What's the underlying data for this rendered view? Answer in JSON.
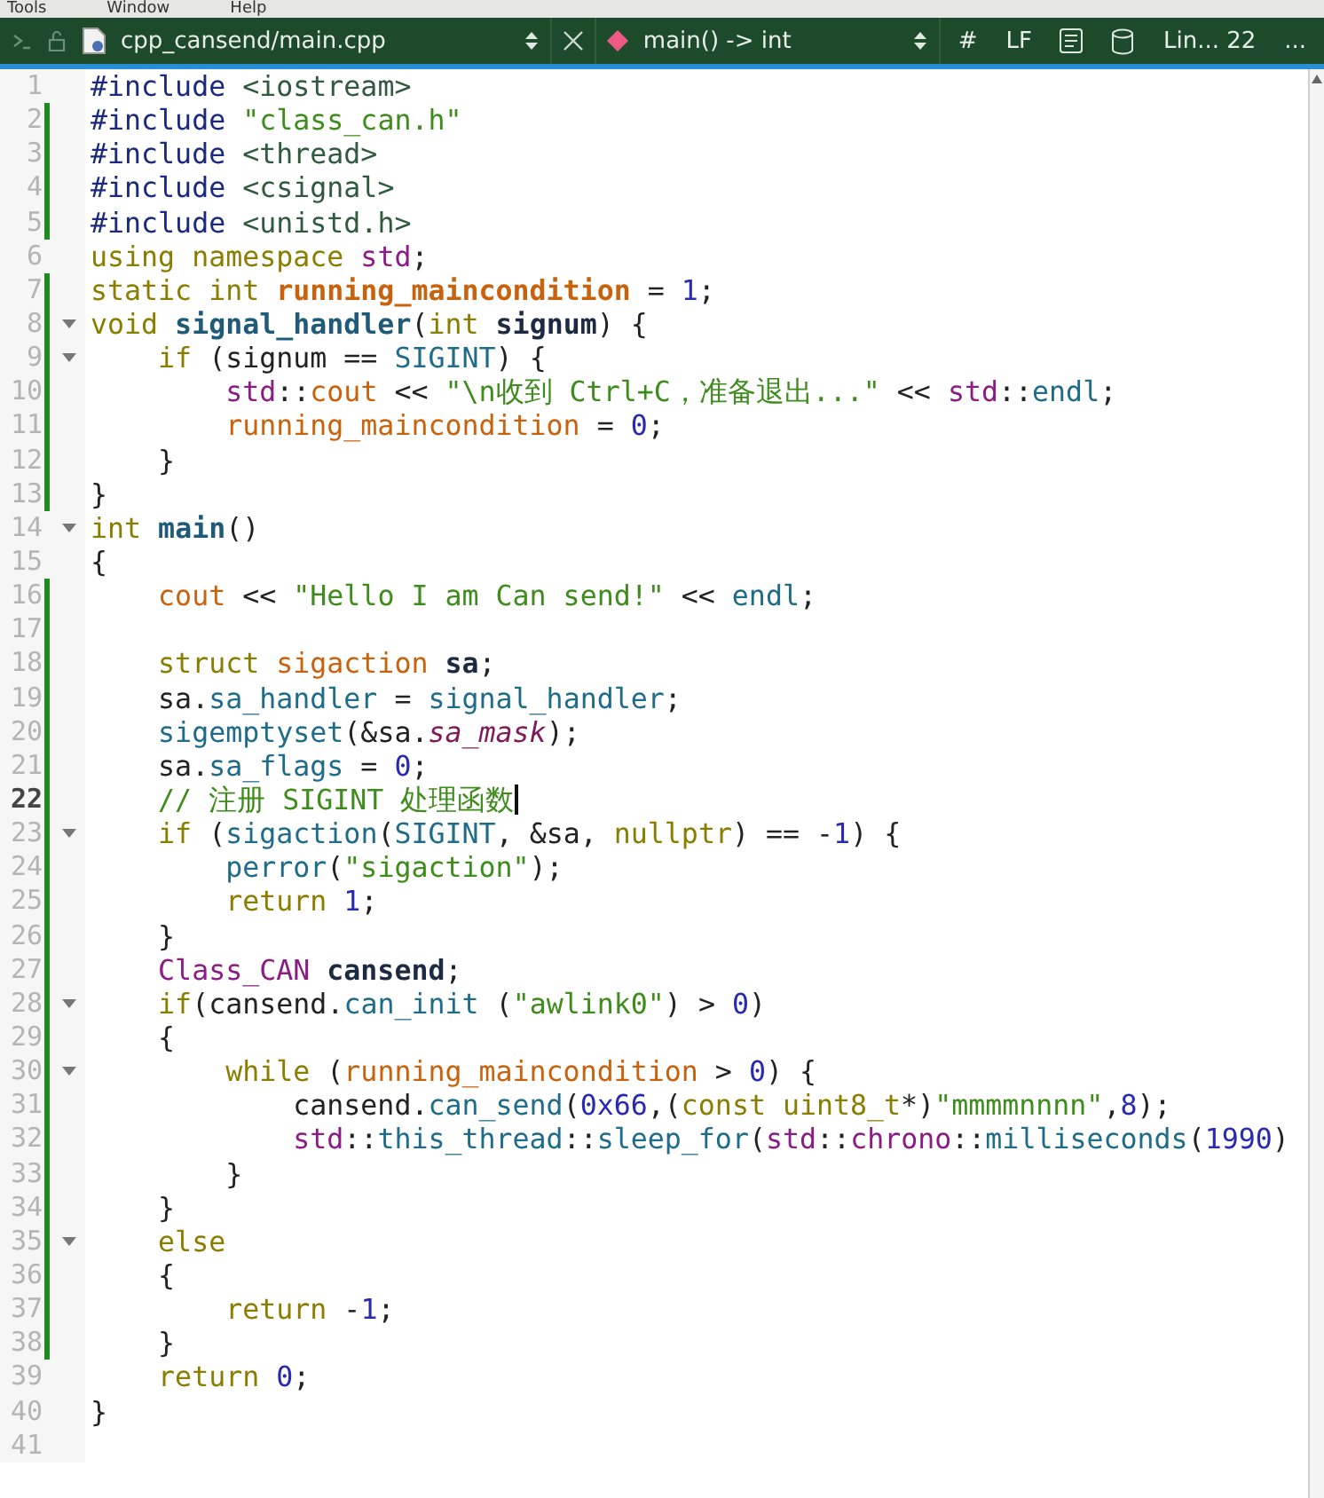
{
  "menu": [
    {
      "label": "Tools"
    },
    {
      "label": "Window"
    },
    {
      "label": "Help"
    }
  ],
  "toolbar": {
    "file": "cpp_cansend/main.cpp",
    "symbol": "main() -> int",
    "hash": "#",
    "line_ending": "LF",
    "position": "Lin... 22",
    "more": "..."
  },
  "editor": {
    "lines": [
      {
        "number": "1",
        "changed": false,
        "fold": false,
        "selected": false,
        "tokens": [
          {
            "kind": "pre",
            "text": "#include"
          },
          {
            "kind": "hdr",
            "text": " <iostream>"
          }
        ]
      },
      {
        "number": "2",
        "changed": true,
        "fold": false,
        "selected": false,
        "tokens": [
          {
            "kind": "pre",
            "text": "#include"
          },
          {
            "kind": "str",
            "text": " \"class_can.h\""
          }
        ]
      },
      {
        "number": "3",
        "changed": true,
        "fold": false,
        "selected": false,
        "tokens": [
          {
            "kind": "pre",
            "text": "#include"
          },
          {
            "kind": "hdr",
            "text": " <thread>"
          }
        ]
      },
      {
        "number": "4",
        "changed": true,
        "fold": false,
        "selected": false,
        "tokens": [
          {
            "kind": "pre",
            "text": "#include"
          },
          {
            "kind": "hdr",
            "text": " <csignal>"
          }
        ]
      },
      {
        "number": "5",
        "changed": true,
        "fold": false,
        "selected": false,
        "tokens": [
          {
            "kind": "pre",
            "text": "#include"
          },
          {
            "kind": "hdr",
            "text": " <unistd.h>"
          }
        ]
      },
      {
        "number": "6",
        "changed": false,
        "fold": false,
        "selected": false,
        "tokens": [
          {
            "kind": "kw",
            "text": "using namespace"
          },
          {
            "kind": "ns",
            "text": " std"
          },
          {
            "kind": "plain",
            "text": ";"
          }
        ]
      },
      {
        "number": "7",
        "changed": true,
        "fold": false,
        "selected": false,
        "tokens": [
          {
            "kind": "kw",
            "text": "static int"
          },
          {
            "kind": "varb",
            "text": " running_maincondition"
          },
          {
            "kind": "plain",
            "text": " = "
          },
          {
            "kind": "num",
            "text": "1"
          },
          {
            "kind": "plain",
            "text": ";"
          }
        ]
      },
      {
        "number": "8",
        "changed": true,
        "fold": true,
        "selected": false,
        "tokens": [
          {
            "kind": "kw",
            "text": "void"
          },
          {
            "kind": "fnb",
            "text": " signal_handler"
          },
          {
            "kind": "plain",
            "text": "("
          },
          {
            "kind": "kw",
            "text": "int"
          },
          {
            "kind": "plainb",
            "text": " signum"
          },
          {
            "kind": "plain",
            "text": ") {"
          }
        ]
      },
      {
        "number": "9",
        "changed": true,
        "fold": true,
        "selected": false,
        "tokens": [
          {
            "kind": "kw",
            "text": "    if"
          },
          {
            "kind": "plain",
            "text": " (signum == "
          },
          {
            "kind": "fn",
            "text": "SIGINT"
          },
          {
            "kind": "plain",
            "text": ") {"
          }
        ]
      },
      {
        "number": "10",
        "changed": true,
        "fold": false,
        "selected": false,
        "tokens": [
          {
            "kind": "ns",
            "text": "        std"
          },
          {
            "kind": "plain",
            "text": "::"
          },
          {
            "kind": "var",
            "text": "cout"
          },
          {
            "kind": "plain",
            "text": " << "
          },
          {
            "kind": "str",
            "text": "\"\\n收到 Ctrl+C，准备退出...\""
          },
          {
            "kind": "plain",
            "text": " << "
          },
          {
            "kind": "ns",
            "text": "std"
          },
          {
            "kind": "plain",
            "text": "::"
          },
          {
            "kind": "fn",
            "text": "endl"
          },
          {
            "kind": "plain",
            "text": ";"
          }
        ]
      },
      {
        "number": "11",
        "changed": true,
        "fold": false,
        "selected": false,
        "tokens": [
          {
            "kind": "var",
            "text": "        running_maincondition"
          },
          {
            "kind": "plain",
            "text": " = "
          },
          {
            "kind": "num",
            "text": "0"
          },
          {
            "kind": "plain",
            "text": ";"
          }
        ]
      },
      {
        "number": "12",
        "changed": true,
        "fold": false,
        "selected": false,
        "tokens": [
          {
            "kind": "plain",
            "text": "    }"
          }
        ]
      },
      {
        "number": "13",
        "changed": true,
        "fold": false,
        "selected": false,
        "tokens": [
          {
            "kind": "plain",
            "text": "}"
          }
        ]
      },
      {
        "number": "14",
        "changed": false,
        "fold": true,
        "selected": false,
        "tokens": [
          {
            "kind": "kw",
            "text": "int"
          },
          {
            "kind": "fnb",
            "text": " main"
          },
          {
            "kind": "plain",
            "text": "()"
          }
        ]
      },
      {
        "number": "15",
        "changed": false,
        "fold": false,
        "selected": false,
        "tokens": [
          {
            "kind": "plain",
            "text": "{"
          }
        ]
      },
      {
        "number": "16",
        "changed": true,
        "fold": false,
        "selected": false,
        "tokens": [
          {
            "kind": "var",
            "text": "    cout"
          },
          {
            "kind": "plain",
            "text": " << "
          },
          {
            "kind": "str",
            "text": "\"Hello I am Can send!\""
          },
          {
            "kind": "plain",
            "text": " << "
          },
          {
            "kind": "fn",
            "text": "endl"
          },
          {
            "kind": "plain",
            "text": ";"
          }
        ]
      },
      {
        "number": "17",
        "changed": true,
        "fold": false,
        "selected": false
      },
      {
        "number": "18",
        "changed": true,
        "fold": false,
        "selected": false,
        "tokens": [
          {
            "kind": "kw",
            "text": "    struct"
          },
          {
            "kind": "var",
            "text": " sigaction"
          },
          {
            "kind": "plainb",
            "text": " sa"
          },
          {
            "kind": "plain",
            "text": ";"
          }
        ]
      },
      {
        "number": "19",
        "changed": true,
        "fold": false,
        "selected": false,
        "tokens": [
          {
            "kind": "plain",
            "text": "    sa."
          },
          {
            "kind": "fn",
            "text": "sa_handler"
          },
          {
            "kind": "plain",
            "text": " = "
          },
          {
            "kind": "fn",
            "text": "signal_handler"
          },
          {
            "kind": "plain",
            "text": ";"
          }
        ]
      },
      {
        "number": "20",
        "changed": true,
        "fold": false,
        "selected": false,
        "tokens": [
          {
            "kind": "fn",
            "text": "    sigemptyset"
          },
          {
            "kind": "plain",
            "text": "(&sa."
          },
          {
            "kind": "ital",
            "text": "sa_mask"
          },
          {
            "kind": "plain",
            "text": ");"
          }
        ]
      },
      {
        "number": "21",
        "changed": true,
        "fold": false,
        "selected": false,
        "tokens": [
          {
            "kind": "plain",
            "text": "    sa."
          },
          {
            "kind": "fn",
            "text": "sa_flags"
          },
          {
            "kind": "plain",
            "text": " = "
          },
          {
            "kind": "num",
            "text": "0"
          },
          {
            "kind": "plain",
            "text": ";"
          }
        ]
      },
      {
        "number": "22",
        "changed": true,
        "fold": false,
        "selected": true,
        "tokens": [
          {
            "kind": "cmt",
            "text": "    // 注册 SIGINT 处理函数"
          }
        ]
      },
      {
        "number": "23",
        "changed": true,
        "fold": true,
        "selected": false,
        "tokens": [
          {
            "kind": "kw",
            "text": "    if"
          },
          {
            "kind": "plain",
            "text": " ("
          },
          {
            "kind": "fn",
            "text": "sigaction"
          },
          {
            "kind": "plain",
            "text": "("
          },
          {
            "kind": "fn",
            "text": "SIGINT"
          },
          {
            "kind": "plain",
            "text": ", &sa, "
          },
          {
            "kind": "kw",
            "text": "nullptr"
          },
          {
            "kind": "plain",
            "text": ") == -"
          },
          {
            "kind": "num",
            "text": "1"
          },
          {
            "kind": "plain",
            "text": ") {"
          }
        ]
      },
      {
        "number": "24",
        "changed": true,
        "fold": false,
        "selected": false,
        "tokens": [
          {
            "kind": "fn",
            "text": "        perror"
          },
          {
            "kind": "plain",
            "text": "("
          },
          {
            "kind": "str",
            "text": "\"sigaction\""
          },
          {
            "kind": "plain",
            "text": ");"
          }
        ]
      },
      {
        "number": "25",
        "changed": true,
        "fold": false,
        "selected": false,
        "tokens": [
          {
            "kind": "kw",
            "text": "        return"
          },
          {
            "kind": "num",
            "text": " 1"
          },
          {
            "kind": "plain",
            "text": ";"
          }
        ]
      },
      {
        "number": "26",
        "changed": true,
        "fold": false,
        "selected": false,
        "tokens": [
          {
            "kind": "plain",
            "text": "    }"
          }
        ]
      },
      {
        "number": "27",
        "changed": true,
        "fold": false,
        "selected": false,
        "tokens": [
          {
            "kind": "ns",
            "text": "    Class_CAN"
          },
          {
            "kind": "plainb",
            "text": " cansend"
          },
          {
            "kind": "plain",
            "text": ";"
          }
        ]
      },
      {
        "number": "28",
        "changed": true,
        "fold": true,
        "selected": false,
        "tokens": [
          {
            "kind": "kw",
            "text": "    if"
          },
          {
            "kind": "plain",
            "text": "(cansend."
          },
          {
            "kind": "fn",
            "text": "can_init"
          },
          {
            "kind": "plain",
            "text": " ("
          },
          {
            "kind": "str",
            "text": "\"awlink0\""
          },
          {
            "kind": "plain",
            "text": ") > "
          },
          {
            "kind": "num",
            "text": "0"
          },
          {
            "kind": "plain",
            "text": ")"
          }
        ]
      },
      {
        "number": "29",
        "changed": true,
        "fold": false,
        "selected": false,
        "tokens": [
          {
            "kind": "plain",
            "text": "    {"
          }
        ]
      },
      {
        "number": "30",
        "changed": true,
        "fold": true,
        "selected": false,
        "tokens": [
          {
            "kind": "kw",
            "text": "        while"
          },
          {
            "kind": "plain",
            "text": " ("
          },
          {
            "kind": "var",
            "text": "running_maincondition"
          },
          {
            "kind": "plain",
            "text": " > "
          },
          {
            "kind": "num",
            "text": "0"
          },
          {
            "kind": "plain",
            "text": ") {"
          }
        ]
      },
      {
        "number": "31",
        "changed": true,
        "fold": false,
        "selected": false,
        "tokens": [
          {
            "kind": "plain",
            "text": "            cansend."
          },
          {
            "kind": "fn",
            "text": "can_send"
          },
          {
            "kind": "plain",
            "text": "("
          },
          {
            "kind": "num",
            "text": "0x66"
          },
          {
            "kind": "plain",
            "text": ",("
          },
          {
            "kind": "kw",
            "text": "const uint8_t"
          },
          {
            "kind": "plain",
            "text": "*)"
          },
          {
            "kind": "str",
            "text": "\"mmmmnnnn\""
          },
          {
            "kind": "plain",
            "text": ","
          },
          {
            "kind": "num",
            "text": "8"
          },
          {
            "kind": "plain",
            "text": ");"
          }
        ]
      },
      {
        "number": "32",
        "changed": true,
        "fold": false,
        "selected": false,
        "tokens": [
          {
            "kind": "ns",
            "text": "            std"
          },
          {
            "kind": "plain",
            "text": "::"
          },
          {
            "kind": "fn",
            "text": "this_thread"
          },
          {
            "kind": "plain",
            "text": "::"
          },
          {
            "kind": "fn",
            "text": "sleep_for"
          },
          {
            "kind": "plain",
            "text": "("
          },
          {
            "kind": "ns",
            "text": "std"
          },
          {
            "kind": "plain",
            "text": "::"
          },
          {
            "kind": "ns",
            "text": "chrono"
          },
          {
            "kind": "plain",
            "text": "::"
          },
          {
            "kind": "fn",
            "text": "milliseconds"
          },
          {
            "kind": "plain",
            "text": "("
          },
          {
            "kind": "num",
            "text": "1990"
          },
          {
            "kind": "plain",
            "text": ")"
          }
        ]
      },
      {
        "number": "33",
        "changed": true,
        "fold": false,
        "selected": false,
        "tokens": [
          {
            "kind": "plain",
            "text": "        }"
          }
        ]
      },
      {
        "number": "34",
        "changed": true,
        "fold": false,
        "selected": false,
        "tokens": [
          {
            "kind": "plain",
            "text": "    }"
          }
        ]
      },
      {
        "number": "35",
        "changed": true,
        "fold": true,
        "selected": false,
        "tokens": [
          {
            "kind": "kw",
            "text": "    else"
          }
        ]
      },
      {
        "number": "36",
        "changed": true,
        "fold": false,
        "selected": false,
        "tokens": [
          {
            "kind": "plain",
            "text": "    {"
          }
        ]
      },
      {
        "number": "37",
        "changed": true,
        "fold": false,
        "selected": false,
        "tokens": [
          {
            "kind": "kw",
            "text": "        return"
          },
          {
            "kind": "plain",
            "text": " -"
          },
          {
            "kind": "num",
            "text": "1"
          },
          {
            "kind": "plain",
            "text": ";"
          }
        ]
      },
      {
        "number": "38",
        "changed": true,
        "fold": false,
        "selected": false,
        "tokens": [
          {
            "kind": "plain",
            "text": "    }"
          }
        ]
      },
      {
        "number": "39",
        "changed": false,
        "fold": false,
        "selected": false,
        "tokens": [
          {
            "kind": "kw",
            "text": "    return"
          },
          {
            "kind": "num",
            "text": " 0"
          },
          {
            "kind": "plain",
            "text": ";"
          }
        ]
      },
      {
        "number": "40",
        "changed": false,
        "fold": false,
        "selected": false,
        "tokens": [
          {
            "kind": "plain",
            "text": "}"
          }
        ]
      },
      {
        "number": "41",
        "changed": false,
        "fold": false,
        "selected": false
      }
    ]
  }
}
